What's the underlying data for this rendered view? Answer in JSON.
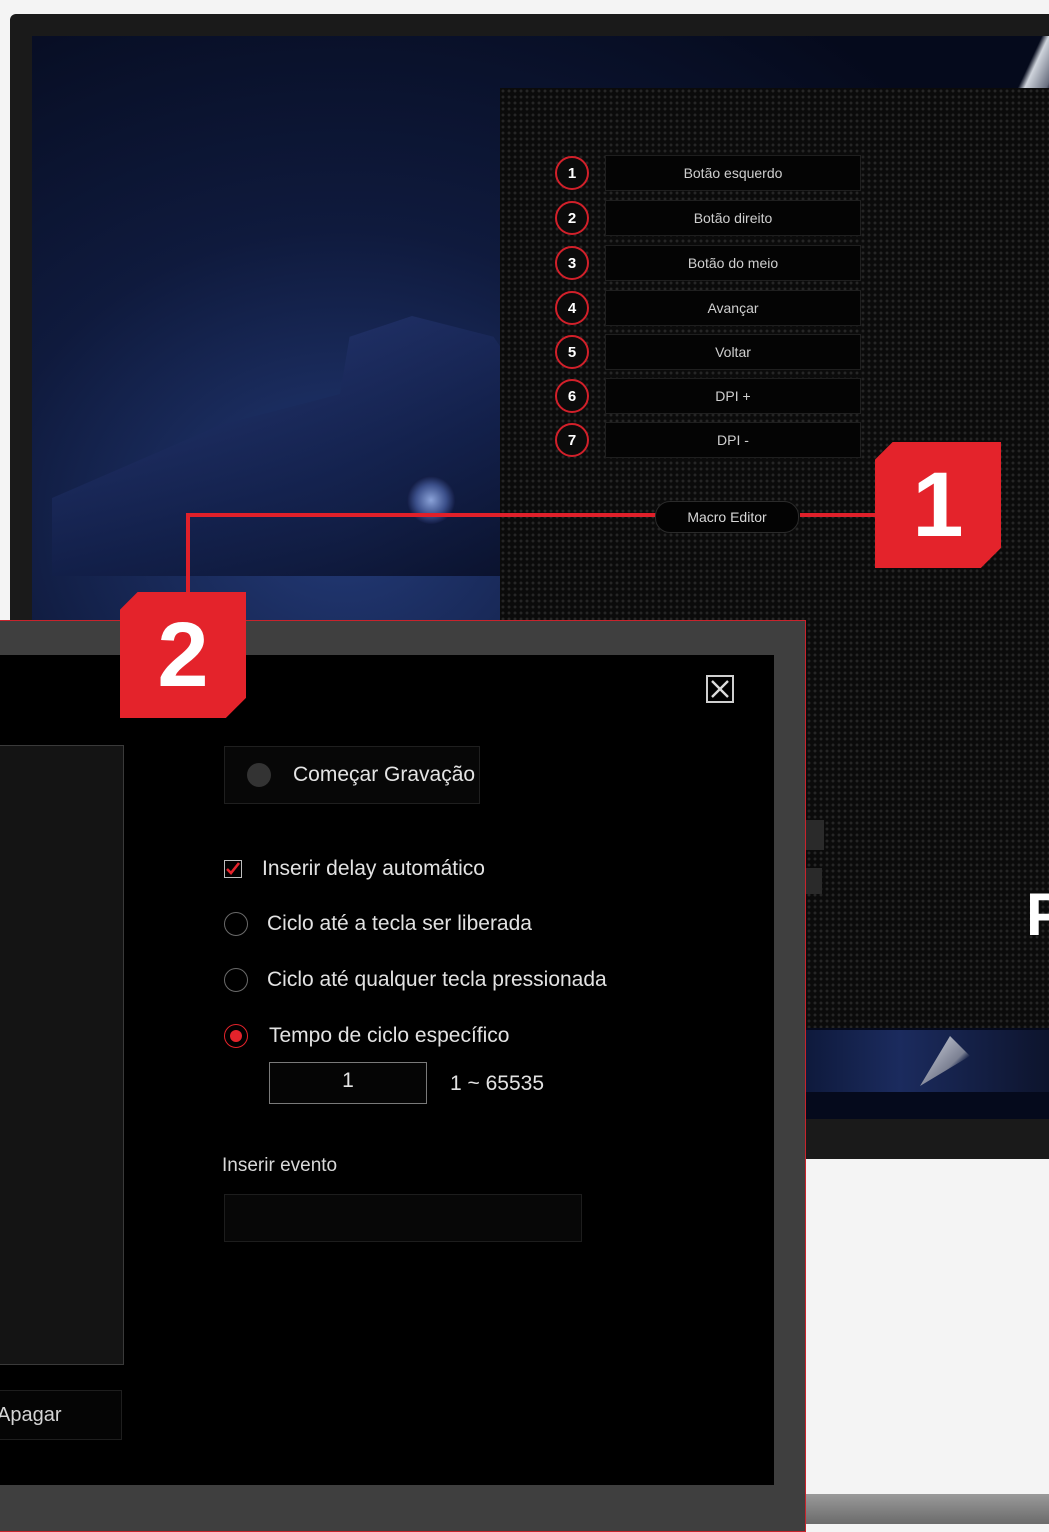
{
  "panel": {
    "buttons": [
      {
        "num": "1",
        "label": "Botão esquerdo"
      },
      {
        "num": "2",
        "label": "Botão direito"
      },
      {
        "num": "3",
        "label": "Botão do meio"
      },
      {
        "num": "4",
        "label": "Avançar"
      },
      {
        "num": "5",
        "label": "Voltar"
      },
      {
        "num": "6",
        "label": "DPI +"
      },
      {
        "num": "7",
        "label": "DPI -"
      }
    ],
    "macro_editor_label": "Macro Editor",
    "cut_letter": "P"
  },
  "callouts": {
    "one": "1",
    "two": "2"
  },
  "dialog": {
    "record_label": "Começar Gravação",
    "auto_delay_label": "Inserir delay automático",
    "auto_delay_checked": true,
    "loop_options": [
      {
        "label": "Ciclo até a tecla ser liberada",
        "selected": false
      },
      {
        "label": "Ciclo até qualquer tecla pressionada",
        "selected": false
      },
      {
        "label": "Tempo de ciclo específico",
        "selected": true
      }
    ],
    "cycle_value": "1",
    "cycle_range": "1 ~ 65535",
    "insert_event_label": "Inserir evento",
    "delete_label": "Apagar"
  },
  "colors": {
    "accent": "#e4232b",
    "dialog_bg": "#000000"
  }
}
